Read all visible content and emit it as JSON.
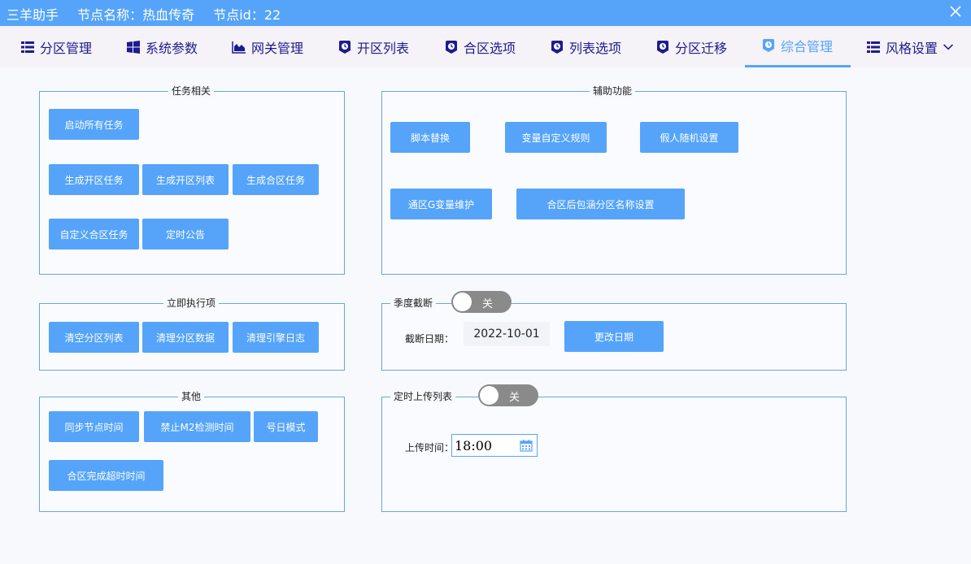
{
  "titlebar": {
    "app": "三羊助手",
    "node_name": "节点名称：热血传奇",
    "node_id": "节点id：22"
  },
  "tabs": [
    {
      "label": "分区管理",
      "icon": "list-icon"
    },
    {
      "label": "系统参数",
      "icon": "windows-icon"
    },
    {
      "label": "网关管理",
      "icon": "area-chart-icon"
    },
    {
      "label": "开区列表",
      "icon": "clock-badge-icon"
    },
    {
      "label": "合区选项",
      "icon": "clock-badge-icon"
    },
    {
      "label": "列表选项",
      "icon": "clock-badge-icon"
    },
    {
      "label": "分区迁移",
      "icon": "clock-badge-icon"
    },
    {
      "label": "综合管理",
      "icon": "clock-badge-icon",
      "active": true
    },
    {
      "label": "风格设置",
      "icon": "list-icon",
      "dropdown": true
    }
  ],
  "task_group": {
    "title": "任务相关",
    "buttons": [
      "启动所有任务",
      "生成开区任务",
      "生成开区列表",
      "生成合区任务",
      "自定义合区任务",
      "定时公告"
    ]
  },
  "aux_group": {
    "title": "辅助功能",
    "buttons": [
      "脚本替换",
      "变量自定义规则",
      "假人随机设置",
      "通区G变量维护",
      "合区后包涵分区名称设置"
    ]
  },
  "exec_group": {
    "title": "立即执行项",
    "buttons": [
      "清空分区列表",
      "清理分区数据",
      "清理引擎日志"
    ]
  },
  "season_group": {
    "title": "季度截断",
    "toggle_label": "关",
    "date_label": "截断日期：",
    "date_value": "2022-10-01",
    "change_button": "更改日期"
  },
  "other_group": {
    "title": "其他",
    "buttons": [
      "同步节点时间",
      "禁止M2检测时间",
      "号日模式",
      "合区完成超时时间"
    ]
  },
  "upload_group": {
    "title": "定时上传列表",
    "toggle_label": "关",
    "time_label": "上传时间：",
    "time_value": "18:00"
  },
  "colors": {
    "accent": "#55a4fa",
    "tab_text": "#1e1b8e",
    "border": "#6aa6da",
    "toggle_off": "#8a8a8a"
  }
}
